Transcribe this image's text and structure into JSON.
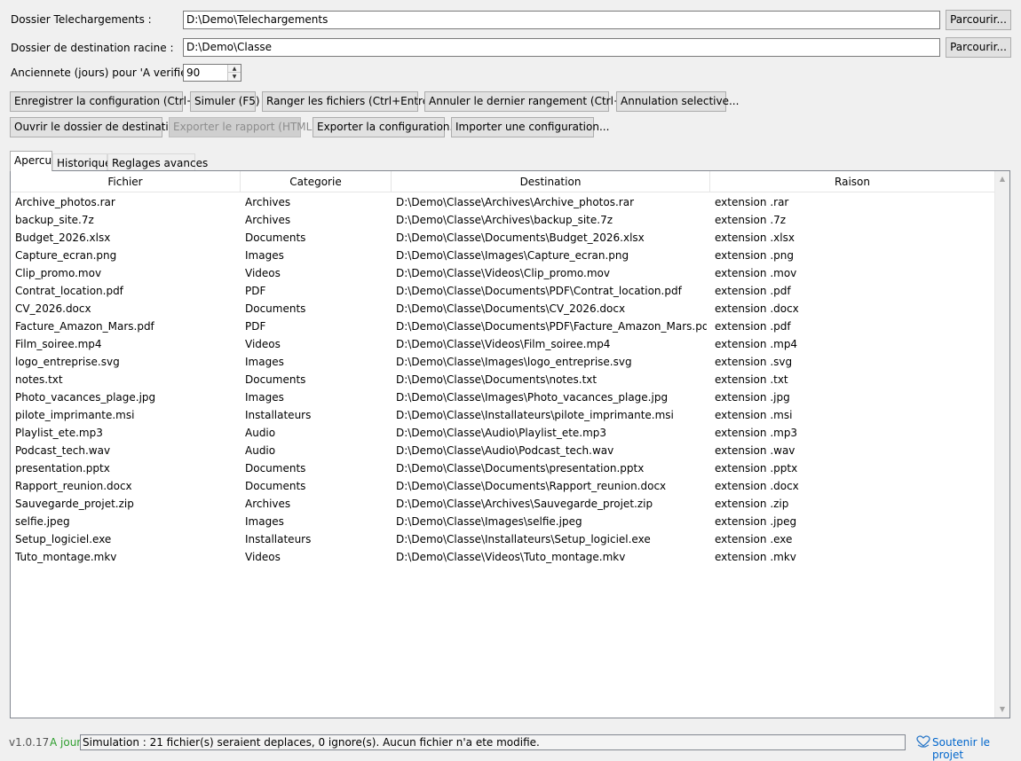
{
  "fields": {
    "downloads_label": "Dossier Telechargements :",
    "downloads_value": "D:\\Demo\\Telechargements",
    "dest_label": "Dossier de destination racine :",
    "dest_value": "D:\\Demo\\Classe",
    "age_label": "Anciennete (jours) pour 'A verifier' :",
    "age_value": "90",
    "browse_label": "Parcourir..."
  },
  "toolbar": {
    "save": "Enregistrer la configuration (Ctrl+S)",
    "simulate": "Simuler (F5)",
    "sort": "Ranger les fichiers (Ctrl+Entree)",
    "undo_last": "Annuler le dernier rangement (Ctrl+Z)",
    "undo_selective": "Annulation selective...",
    "open_dest": "Ouvrir le dossier de destination",
    "export_report": "Exporter le rapport (HTML)",
    "export_config": "Exporter la configuration...",
    "import_config": "Importer une configuration..."
  },
  "tabs": [
    "Apercu",
    "Historique",
    "Reglages avances"
  ],
  "table": {
    "columns": [
      "Fichier",
      "Categorie",
      "Destination",
      "Raison"
    ],
    "rows": [
      [
        "Archive_photos.rar",
        "Archives",
        "D:\\Demo\\Classe\\Archives\\Archive_photos.rar",
        "extension .rar"
      ],
      [
        "backup_site.7z",
        "Archives",
        "D:\\Demo\\Classe\\Archives\\backup_site.7z",
        "extension .7z"
      ],
      [
        "Budget_2026.xlsx",
        "Documents",
        "D:\\Demo\\Classe\\Documents\\Budget_2026.xlsx",
        "extension .xlsx"
      ],
      [
        "Capture_ecran.png",
        "Images",
        "D:\\Demo\\Classe\\Images\\Capture_ecran.png",
        "extension .png"
      ],
      [
        "Clip_promo.mov",
        "Videos",
        "D:\\Demo\\Classe\\Videos\\Clip_promo.mov",
        "extension .mov"
      ],
      [
        "Contrat_location.pdf",
        "PDF",
        "D:\\Demo\\Classe\\Documents\\PDF\\Contrat_location.pdf",
        "extension .pdf"
      ],
      [
        "CV_2026.docx",
        "Documents",
        "D:\\Demo\\Classe\\Documents\\CV_2026.docx",
        "extension .docx"
      ],
      [
        "Facture_Amazon_Mars.pdf",
        "PDF",
        "D:\\Demo\\Classe\\Documents\\PDF\\Facture_Amazon_Mars.pdf",
        "extension .pdf"
      ],
      [
        "Film_soiree.mp4",
        "Videos",
        "D:\\Demo\\Classe\\Videos\\Film_soiree.mp4",
        "extension .mp4"
      ],
      [
        "logo_entreprise.svg",
        "Images",
        "D:\\Demo\\Classe\\Images\\logo_entreprise.svg",
        "extension .svg"
      ],
      [
        "notes.txt",
        "Documents",
        "D:\\Demo\\Classe\\Documents\\notes.txt",
        "extension .txt"
      ],
      [
        "Photo_vacances_plage.jpg",
        "Images",
        "D:\\Demo\\Classe\\Images\\Photo_vacances_plage.jpg",
        "extension .jpg"
      ],
      [
        "pilote_imprimante.msi",
        "Installateurs",
        "D:\\Demo\\Classe\\Installateurs\\pilote_imprimante.msi",
        "extension .msi"
      ],
      [
        "Playlist_ete.mp3",
        "Audio",
        "D:\\Demo\\Classe\\Audio\\Playlist_ete.mp3",
        "extension .mp3"
      ],
      [
        "Podcast_tech.wav",
        "Audio",
        "D:\\Demo\\Classe\\Audio\\Podcast_tech.wav",
        "extension .wav"
      ],
      [
        "presentation.pptx",
        "Documents",
        "D:\\Demo\\Classe\\Documents\\presentation.pptx",
        "extension .pptx"
      ],
      [
        "Rapport_reunion.docx",
        "Documents",
        "D:\\Demo\\Classe\\Documents\\Rapport_reunion.docx",
        "extension .docx"
      ],
      [
        "Sauvegarde_projet.zip",
        "Archives",
        "D:\\Demo\\Classe\\Archives\\Sauvegarde_projet.zip",
        "extension .zip"
      ],
      [
        "selfie.jpeg",
        "Images",
        "D:\\Demo\\Classe\\Images\\selfie.jpeg",
        "extension .jpeg"
      ],
      [
        "Setup_logiciel.exe",
        "Installateurs",
        "D:\\Demo\\Classe\\Installateurs\\Setup_logiciel.exe",
        "extension .exe"
      ],
      [
        "Tuto_montage.mkv",
        "Videos",
        "D:\\Demo\\Classe\\Videos\\Tuto_montage.mkv",
        "extension .mkv"
      ]
    ]
  },
  "status": {
    "version": "v1.0.17",
    "update_state": "A jour",
    "update_color": "#2e9e2e",
    "message": "Simulation : 21 fichier(s) seraient deplaces, 0 ignore(s). Aucun fichier n'a ete modifie.",
    "support_link": "Soutenir le projet",
    "link_color": "#0066cc"
  },
  "icons": {
    "support": "heart-hands-icon",
    "spin_up": "chevron-up-icon",
    "spin_down": "chevron-down-icon",
    "scroll_up": "chevron-up-icon",
    "scroll_down": "chevron-down-icon"
  }
}
